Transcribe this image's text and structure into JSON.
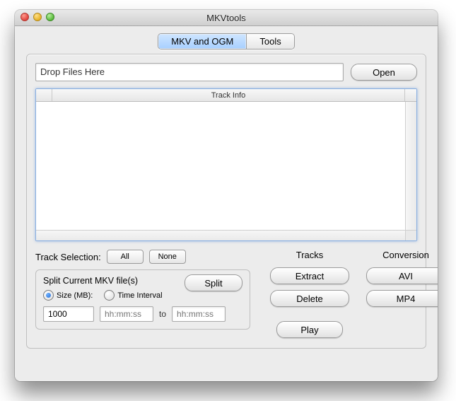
{
  "window": {
    "title": "MKVtools"
  },
  "tabs": {
    "mkv": "MKV and OGM",
    "tools": "Tools"
  },
  "drop": {
    "placeholder": "Drop Files Here",
    "open": "Open"
  },
  "tracklist": {
    "header": "Track Info"
  },
  "selection": {
    "label": "Track Selection:",
    "all": "All",
    "none": "None"
  },
  "split": {
    "legend": "Split Current MKV file(s)",
    "button": "Split",
    "size_label": "Size (MB):",
    "time_label": "Time Interval",
    "size_value": "1000",
    "time_ph": "hh:mm:ss",
    "to": "to"
  },
  "tracks": {
    "head": "Tracks",
    "extract": "Extract",
    "delete": "Delete",
    "play": "Play"
  },
  "conv": {
    "head": "Conversion",
    "avi": "AVI",
    "mp4": "MP4"
  }
}
